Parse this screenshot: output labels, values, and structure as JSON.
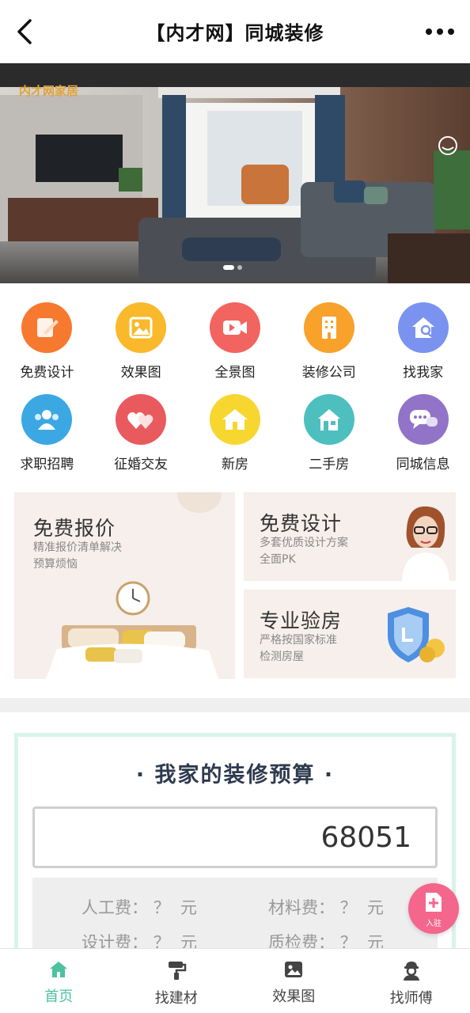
{
  "header": {
    "title": "【内才网】同城装修",
    "back_icon": "chevron-left-icon",
    "more_icon": "more-dots-icon"
  },
  "banner": {
    "logo_text": "内才网家居",
    "service_icon": "headset-icon",
    "scene": "living-room-interior"
  },
  "grid": {
    "items": [
      {
        "label": "免费设计",
        "icon": "design-pen-icon",
        "color": "#f7782f"
      },
      {
        "label": "效果图",
        "icon": "image-icon",
        "color": "#f9b92b"
      },
      {
        "label": "全景图",
        "icon": "video-camera-icon",
        "color": "#f2645f"
      },
      {
        "label": "装修公司",
        "icon": "building-icon",
        "color": "#f8a12b"
      },
      {
        "label": "找我家",
        "icon": "house-search-icon",
        "color": "#7b93f0"
      },
      {
        "label": "求职招聘",
        "icon": "people-icon",
        "color": "#3ba8e4"
      },
      {
        "label": "征婚交友",
        "icon": "hearts-icon",
        "color": "#e95a5e"
      },
      {
        "label": "新房",
        "icon": "house-icon",
        "color": "#f7d630"
      },
      {
        "label": "二手房",
        "icon": "house-door-icon",
        "color": "#4dbfbe"
      },
      {
        "label": "同城信息",
        "icon": "chat-bubbles-icon",
        "color": "#9174c8"
      }
    ]
  },
  "promos": {
    "quote": {
      "title": "免费报价",
      "sub1": "精准报价清单解决",
      "sub2": "预算烦恼"
    },
    "design": {
      "title": "免费设计",
      "sub1": "多套优质设计方案",
      "sub2": "全面PK"
    },
    "inspect": {
      "title": "专业验房",
      "sub1": "严格按国家标准",
      "sub2": "检测房屋"
    }
  },
  "budget": {
    "title": "· 我家的装修预算 ·",
    "area_value": "68051",
    "fees": [
      {
        "label": "人工费：",
        "value": "？",
        "unit": "元"
      },
      {
        "label": "材料费：",
        "value": "？",
        "unit": "元"
      },
      {
        "label": "设计费：",
        "value": "？",
        "unit": "元"
      },
      {
        "label": "质检费：",
        "value": "？",
        "unit": "元"
      }
    ]
  },
  "fab": {
    "label": "入驻",
    "icon": "add-document-icon"
  },
  "tabs": [
    {
      "label": "首页",
      "icon": "home-icon",
      "active": true
    },
    {
      "label": "找建材",
      "icon": "paint-roller-icon",
      "active": false
    },
    {
      "label": "效果图",
      "icon": "image-icon",
      "active": false
    },
    {
      "label": "找师傅",
      "icon": "worker-icon",
      "active": false
    }
  ],
  "colors": {
    "accent": "#4cc2a0",
    "promo_bg": "#f6efec",
    "budget_border": "#d8f4ea",
    "fab": "#f4668c"
  }
}
